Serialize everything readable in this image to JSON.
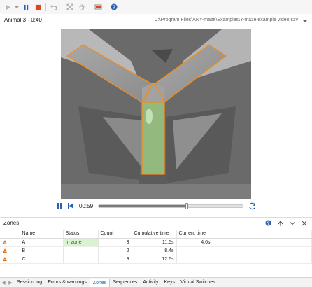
{
  "toolbar": {
    "buttons": [
      "play-icon",
      "dropdown-caret-icon",
      "pause-icon",
      "stop-icon",
      "undo-icon",
      "fit-icon",
      "hand-icon",
      "record-icon",
      "help-icon"
    ]
  },
  "title": {
    "animal": "Animal 3 - 0:40",
    "path": "C:\\Program Files\\ANY-maze\\Examples\\Y-maze example video.szv"
  },
  "playback": {
    "time": "00:59",
    "progress": 0.61
  },
  "zones_panel": {
    "title": "Zones",
    "columns": [
      "",
      "Name",
      "Status",
      "Count",
      "Cumulative time",
      "Current time"
    ],
    "rows": [
      {
        "name": "A",
        "status": "In zone",
        "count": "3",
        "cumulative": "11.5s",
        "current": "4.6s"
      },
      {
        "name": "B",
        "status": "",
        "count": "2",
        "cumulative": "8.4s",
        "current": ""
      },
      {
        "name": "C",
        "status": "",
        "count": "3",
        "cumulative": "12.6s",
        "current": ""
      }
    ]
  },
  "tabs": {
    "items": [
      "Session log",
      "Errors & warnings",
      "Zones",
      "Sequences",
      "Activity",
      "Keys",
      "Virtual Switches"
    ],
    "active": "Zones"
  },
  "colors": {
    "zone_outline": "#f08c1e",
    "zone_active_fill": "#8ed36a",
    "in_zone_bg": "#d9f2d0",
    "accent": "#1a5fb4"
  }
}
